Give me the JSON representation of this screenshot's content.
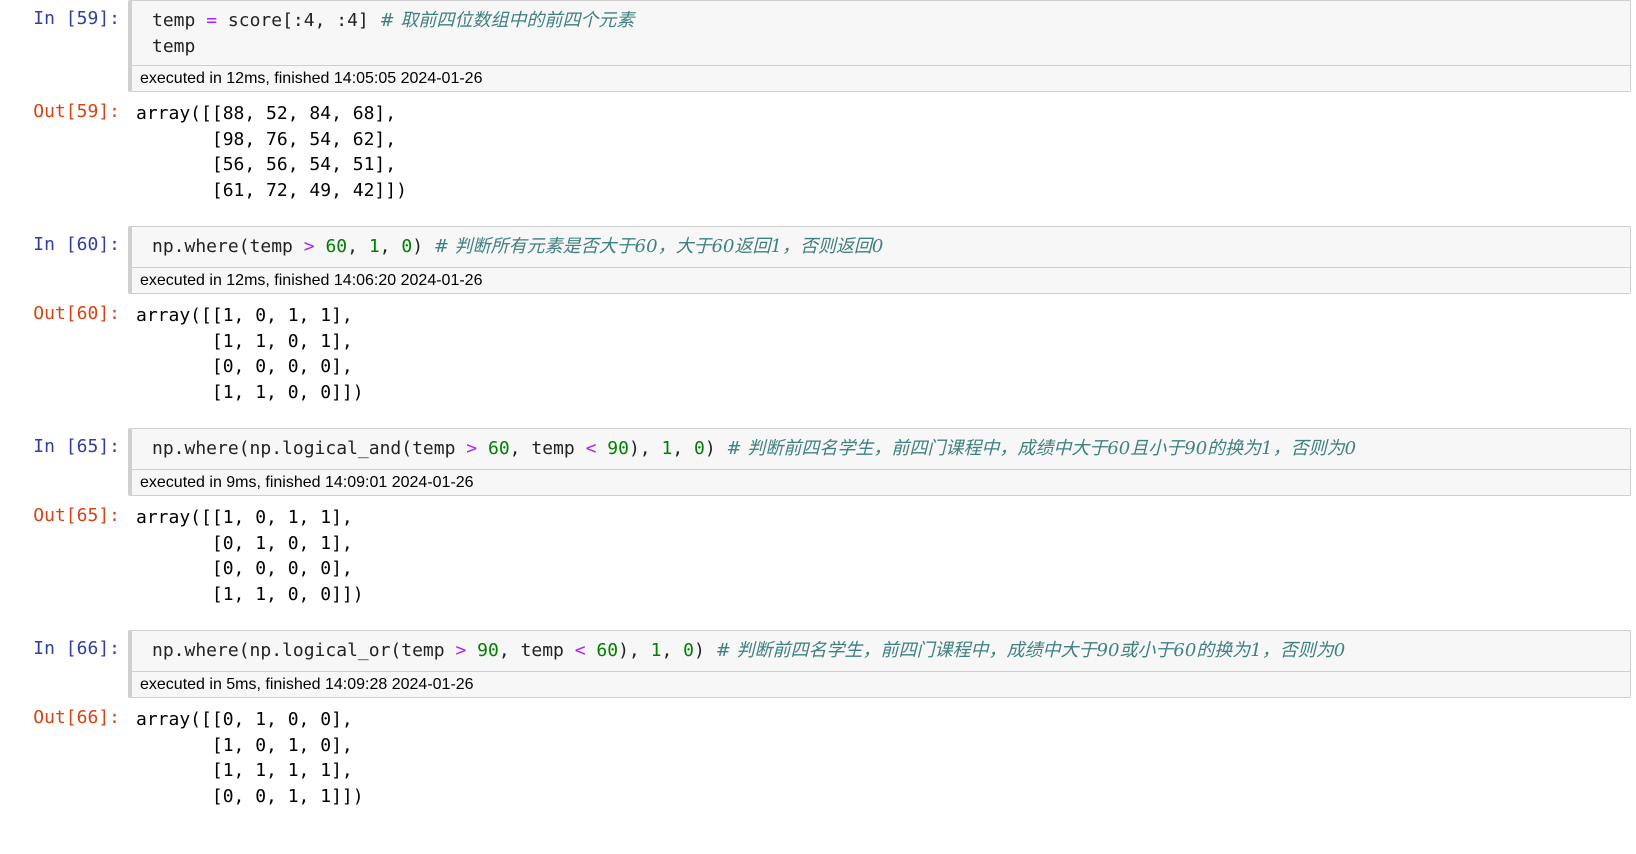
{
  "cells": [
    {
      "in_prompt": "In  [59]:",
      "code_line1": "temp = score[:4, :4]",
      "code_line1_comment": "# 取前四位数组中的前四个元素",
      "code_line2": "temp",
      "exec": "executed in 12ms, finished 14:05:05 2024-01-26",
      "out_prompt": "Out[59]:",
      "output": "array([[88, 52, 84, 68],\n       [98, 76, 54, 62],\n       [56, 56, 54, 51],\n       [61, 72, 49, 42]])"
    },
    {
      "in_prompt": "In  [60]:",
      "code_parts": [
        "np.where(temp",
        ">",
        "60",
        ",",
        "1",
        ",",
        "0",
        ")"
      ],
      "comment": "# 判断所有元素是否大于60，大于60返回1，否则返回0",
      "exec": "executed in 12ms, finished 14:06:20 2024-01-26",
      "out_prompt": "Out[60]:",
      "output": "array([[1, 0, 1, 1],\n       [1, 1, 0, 1],\n       [0, 0, 0, 0],\n       [1, 1, 0, 0]])"
    },
    {
      "in_prompt": "In  [65]:",
      "comment": "# 判断前四名学生，前四门课程中，成绩中大于60且小于90的换为1，否则为0",
      "exec": "executed in 9ms, finished 14:09:01 2024-01-26",
      "out_prompt": "Out[65]:",
      "output": "array([[1, 0, 1, 1],\n       [0, 1, 0, 1],\n       [0, 0, 0, 0],\n       [1, 1, 0, 0]])"
    },
    {
      "in_prompt": "In  [66]:",
      "comment": "# 判断前四名学生，前四门课程中，成绩中大于90或小于60的换为1，否则为0",
      "exec": "executed in 5ms, finished 14:09:28 2024-01-26",
      "out_prompt": "Out[66]:",
      "output": "array([[0, 1, 0, 0],\n       [1, 0, 1, 0],\n       [1, 1, 1, 1],\n       [0, 0, 1, 1]])"
    }
  ],
  "tokens": {
    "np_where": "np.where(",
    "np_where_logical_and": "np.where(np.logical_and(",
    "np_where_logical_or": "np.where(np.logical_or(",
    "temp": "temp",
    "gt": ">",
    "lt": "<",
    "n60": "60",
    "n90": "90",
    "n1": "1",
    "n0": "0",
    "comma": ", ",
    "close": ")",
    "close2": "),",
    "assign": "=",
    "score_slice": "score[:4, :4]"
  },
  "colors": {
    "in_prompt": "#303f9f",
    "out_prompt": "#d84315",
    "operator": "#aa22ff",
    "number": "#008000",
    "comment": "#408080"
  }
}
